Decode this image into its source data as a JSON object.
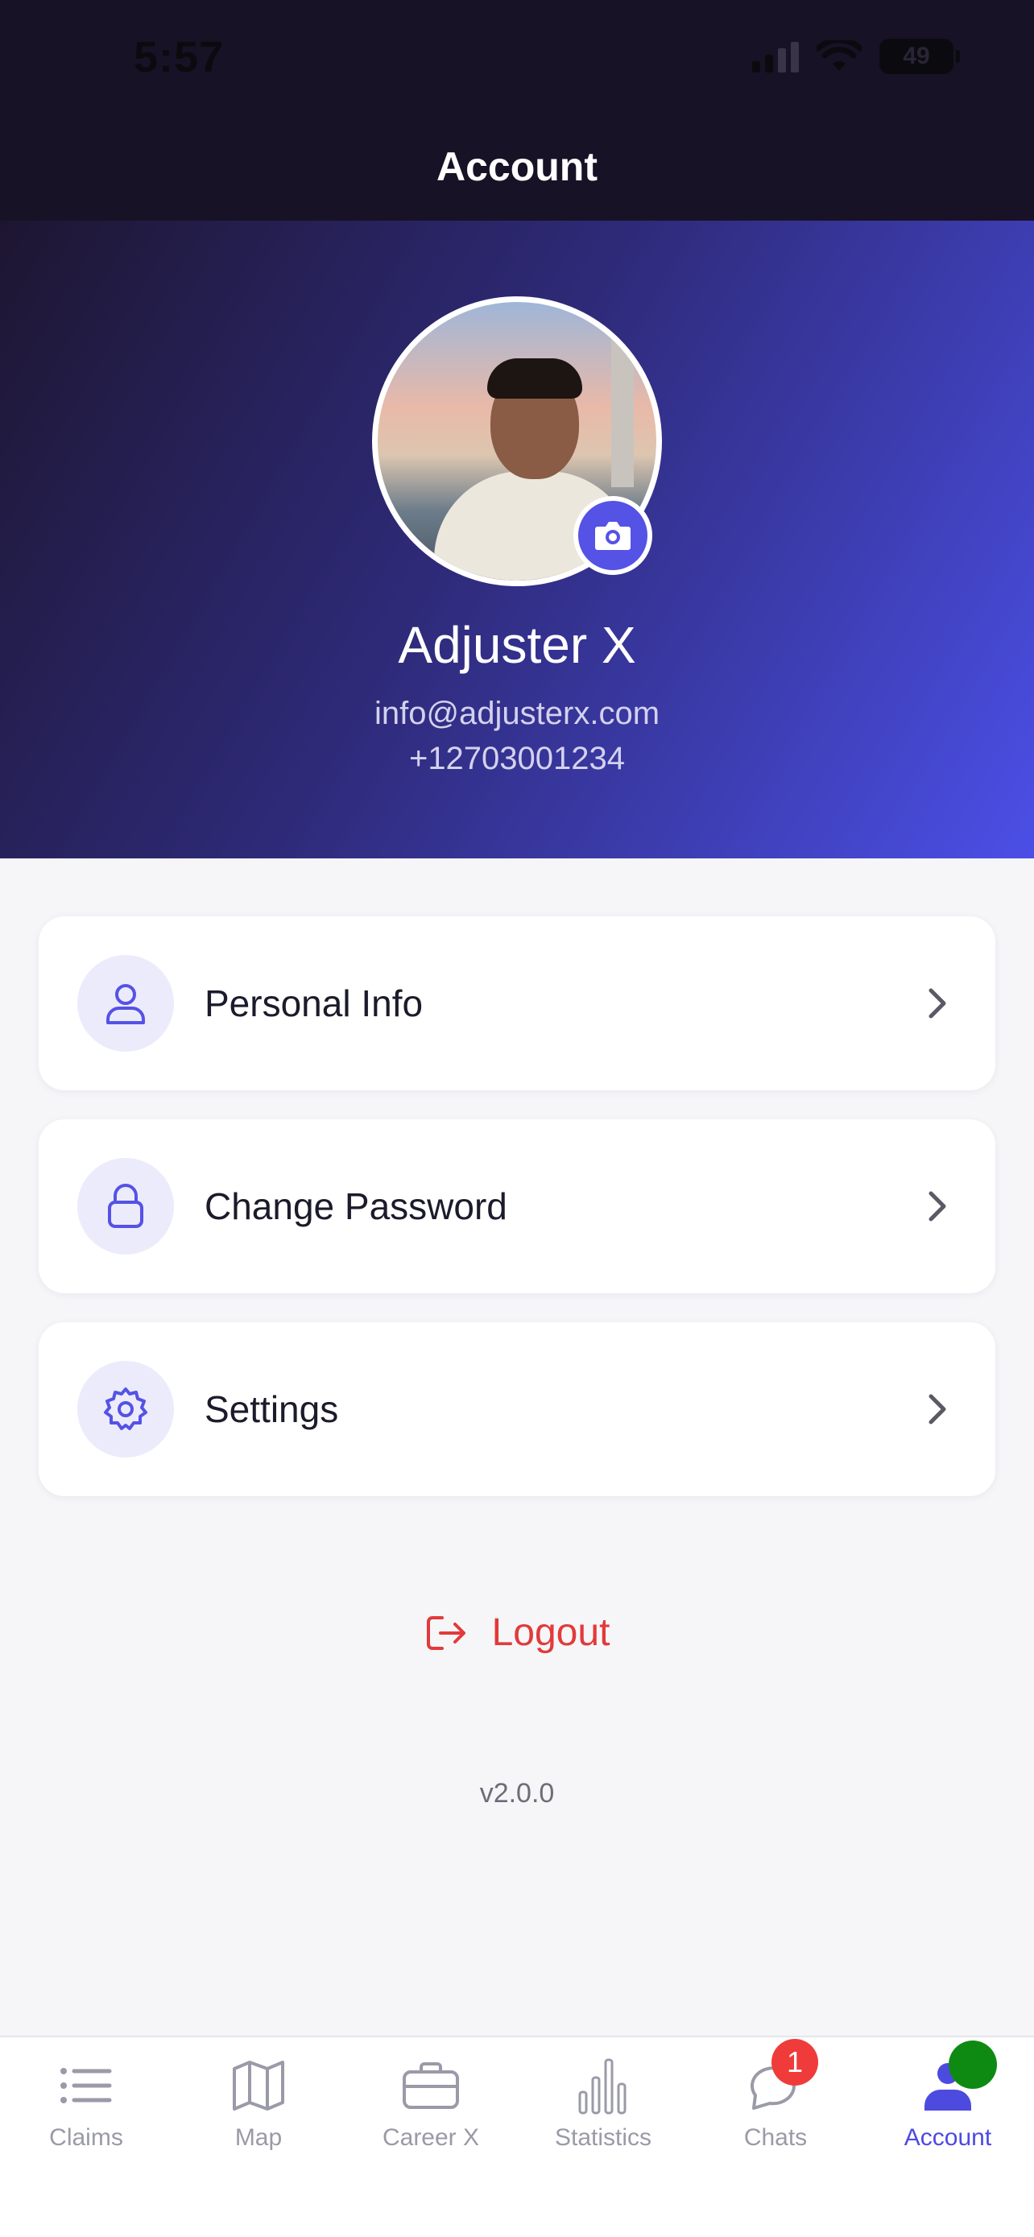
{
  "status_bar": {
    "time": "5:57",
    "battery": "49"
  },
  "nav": {
    "title": "Account"
  },
  "profile": {
    "name": "Adjuster X",
    "email": "info@adjusterx.com",
    "phone": "+12703001234"
  },
  "menu": [
    {
      "label": "Personal Info",
      "icon": "user-icon"
    },
    {
      "label": "Change Password",
      "icon": "lock-icon"
    },
    {
      "label": "Settings",
      "icon": "gear-icon"
    }
  ],
  "logout": {
    "label": "Logout",
    "color": "#e23a3a"
  },
  "version": "v2.0.0",
  "tabs": [
    {
      "label": "Claims",
      "icon": "list-icon",
      "active": false
    },
    {
      "label": "Map",
      "icon": "map-icon",
      "active": false
    },
    {
      "label": "Career X",
      "icon": "briefcase-icon",
      "active": false
    },
    {
      "label": "Statistics",
      "icon": "bar-chart-icon",
      "active": false
    },
    {
      "label": "Chats",
      "icon": "chat-icon",
      "active": false,
      "badge": "1"
    },
    {
      "label": "Account",
      "icon": "user-icon",
      "active": true
    }
  ],
  "colors": {
    "accent": "#4d4ae0",
    "header_dark": "#1d1631",
    "header_light": "#4b4fe6",
    "danger": "#e23a3a"
  }
}
